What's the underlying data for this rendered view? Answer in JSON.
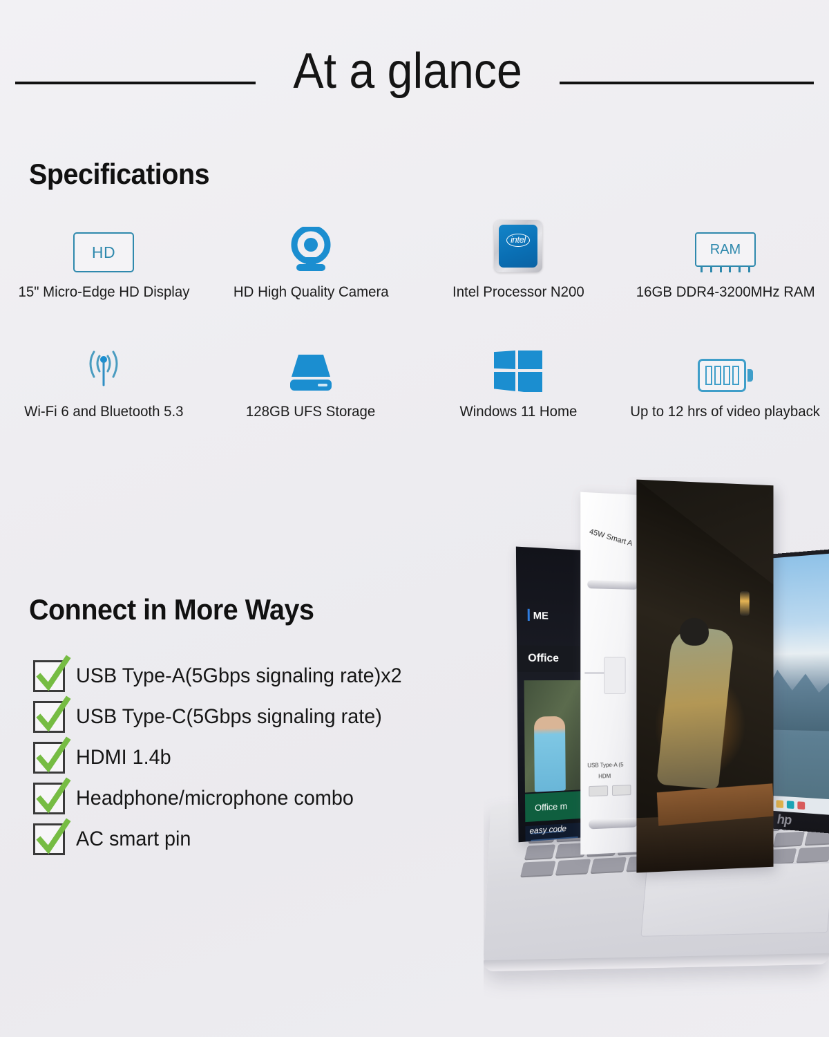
{
  "header": {
    "title": "At a glance"
  },
  "specifications": {
    "heading": "Specifications",
    "items": [
      {
        "icon": "hd-display-icon",
        "icon_text": "HD",
        "label": "15\" Micro-Edge HD Display"
      },
      {
        "icon": "webcam-icon",
        "icon_text": "",
        "label": "HD High Quality Camera"
      },
      {
        "icon": "intel-chip-icon",
        "icon_text": "intel",
        "label": "Intel Processor N200"
      },
      {
        "icon": "ram-icon",
        "icon_text": "RAM",
        "label": "16GB DDR4-3200MHz RAM"
      },
      {
        "icon": "wifi-icon",
        "icon_text": "",
        "label": "Wi-Fi 6 and Bluetooth 5.3"
      },
      {
        "icon": "storage-drive-icon",
        "icon_text": "",
        "label": "128GB UFS Storage"
      },
      {
        "icon": "windows-logo-icon",
        "icon_text": "",
        "label": "Windows 11 Home"
      },
      {
        "icon": "battery-icon",
        "icon_text": "",
        "label": "Up to 12 hrs of video playback"
      }
    ]
  },
  "connect": {
    "heading": "Connect in More Ways",
    "items": [
      "USB Type-A(5Gbps signaling rate)x2",
      "USB Type-C(5Gbps signaling rate)",
      "HDMI 1.4b",
      "Headphone/microphone combo",
      "AC smart pin"
    ]
  },
  "product_image": {
    "panel_dark_title": "ME",
    "panel_dark_subtitle": "Office",
    "panel_dark_greenbar": "Office m",
    "panel_dark_caption": "easy code",
    "panel_white_caption": "45W Smart A",
    "panel_white_port_labels": [
      "USB Type-A (5",
      "HDM"
    ],
    "brand": "hp"
  },
  "colors": {
    "background": "#edecf0",
    "icon_blue": "#1b8ed0",
    "icon_teal": "#2f89ad",
    "check_green": "#76bc43",
    "text_dark": "#161616",
    "rule_black": "#111111"
  }
}
